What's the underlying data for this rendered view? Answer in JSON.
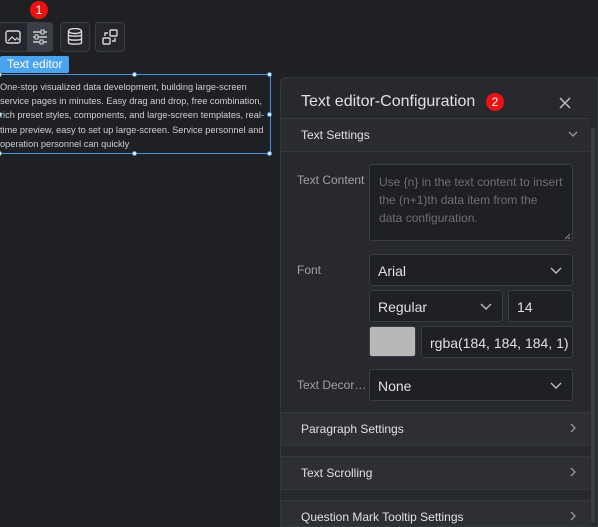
{
  "toolbar": {
    "badge_1": "1",
    "icons": [
      "image-icon",
      "sliders-icon",
      "database-icon",
      "interaction-icon"
    ]
  },
  "component": {
    "chip_label": "Text editor",
    "content": "One-stop visualized data development, building large-screen service pages in minutes. Easy drag and drop, free combination, rich preset styles, components, and large-screen templates, real-time preview, easy to set up large-screen. Service personnel and operation personnel can quickly"
  },
  "panel": {
    "title": "Text editor-Configuration",
    "badge_2": "2",
    "sections": {
      "text_settings": "Text Settings",
      "paragraph_settings": "Paragraph Settings",
      "text_scrolling": "Text Scrolling",
      "tooltip_settings": "Question Mark Tooltip Settings"
    },
    "text_content_label": "Text Content",
    "text_content_placeholder": "Use {n} in the text content to insert the (n+1)th data item from the data configuration.",
    "font_label": "Font",
    "font_family": "Arial",
    "font_weight": "Regular",
    "font_size": "14",
    "font_color_value": "rgba(184, 184, 184, 1)",
    "font_color_hex": "#b8b8b8",
    "decoration_label": "Text Decor…",
    "decoration_value": "None"
  }
}
